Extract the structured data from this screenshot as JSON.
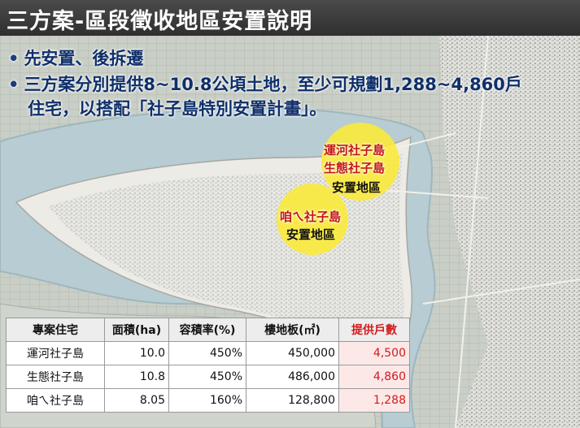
{
  "title": "三方案-區段徵收地區安置說明",
  "bullets": [
    "先安置、後拆遷",
    "三方案分別提供8~10.8公頃土地，至少可規劃1,288~4,860戶",
    "住宅，以搭配「社子島特別安置計畫」。"
  ],
  "map_labels": {
    "circle1_line1": "運河社子島",
    "circle1_line2": "生態社子島",
    "circle1_line3": "安置地區",
    "circle2_line1": "咱ㄟ社子島",
    "circle2_line2": "安置地區"
  },
  "table": {
    "headers": [
      "專案住宅",
      "面積(ha)",
      "容積率(%)",
      "樓地板(㎡)",
      "提供戶數"
    ],
    "rows": [
      [
        "運河社子島",
        "10.0",
        "450%",
        "450,000",
        "4,500"
      ],
      [
        "生態社子島",
        "10.8",
        "450%",
        "486,000",
        "4,860"
      ],
      [
        "咱ㄟ社子島",
        "8.05",
        "160%",
        "128,800",
        "1,288"
      ]
    ]
  },
  "colors": {
    "title_bg": "#3a3a3a",
    "bullet_text": "#0f2f6a",
    "highlight_circle": "#fceb37",
    "red_text": "#c21818"
  }
}
